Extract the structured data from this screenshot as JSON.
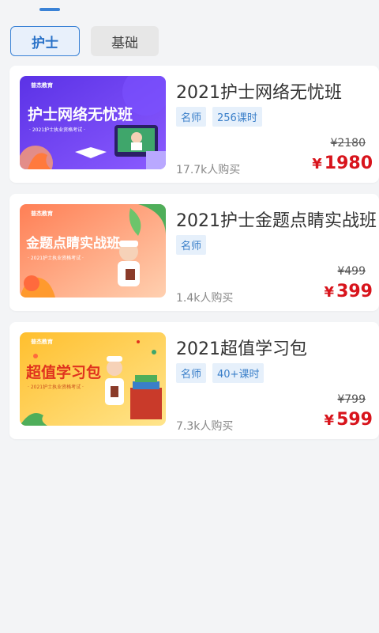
{
  "tabs": [
    {
      "label": "护士",
      "active": true
    },
    {
      "label": "基础",
      "active": false
    }
  ],
  "courses": [
    {
      "title": "2021护士网络无忧班",
      "tags": [
        "名师",
        "256课时"
      ],
      "old_price": "¥2180",
      "currency": "¥",
      "price": "1980",
      "buyers": "17.7k人购买",
      "thumb": {
        "brand": "普杰教育",
        "headline": "护士网络无忧班",
        "sub": "· 2021护士执业资格考试 ·",
        "bg_from": "#6a3df0",
        "bg_to": "#8a5cff",
        "text_color": "#ffffff"
      }
    },
    {
      "title": "2021护士金题点睛实战班",
      "tags": [
        "名师"
      ],
      "old_price": "¥499",
      "currency": "¥",
      "price": "399",
      "buyers": "1.4k人购买",
      "thumb": {
        "brand": "普杰教育",
        "headline": "金题点睛实战班",
        "sub": "· 2021护士执业资格考试 ·",
        "bg_from": "#ff8a5c",
        "bg_to": "#ffc6a3",
        "text_color": "#ffffff"
      }
    },
    {
      "title": "2021超值学习包",
      "tags": [
        "名师",
        "40+课时"
      ],
      "old_price": "¥799",
      "currency": "¥",
      "price": "599",
      "buyers": "7.3k人购买",
      "thumb": {
        "brand": "普杰教育",
        "headline": "超值学习包",
        "sub": "· 2021护士执业资格考试 ·",
        "bg_from": "#ffc83a",
        "bg_to": "#ffe48a",
        "text_color": "#e0321e"
      }
    }
  ],
  "colors": {
    "accent": "#3a82d6",
    "price": "#d8141c",
    "tag_bg": "#e6f0fb"
  }
}
